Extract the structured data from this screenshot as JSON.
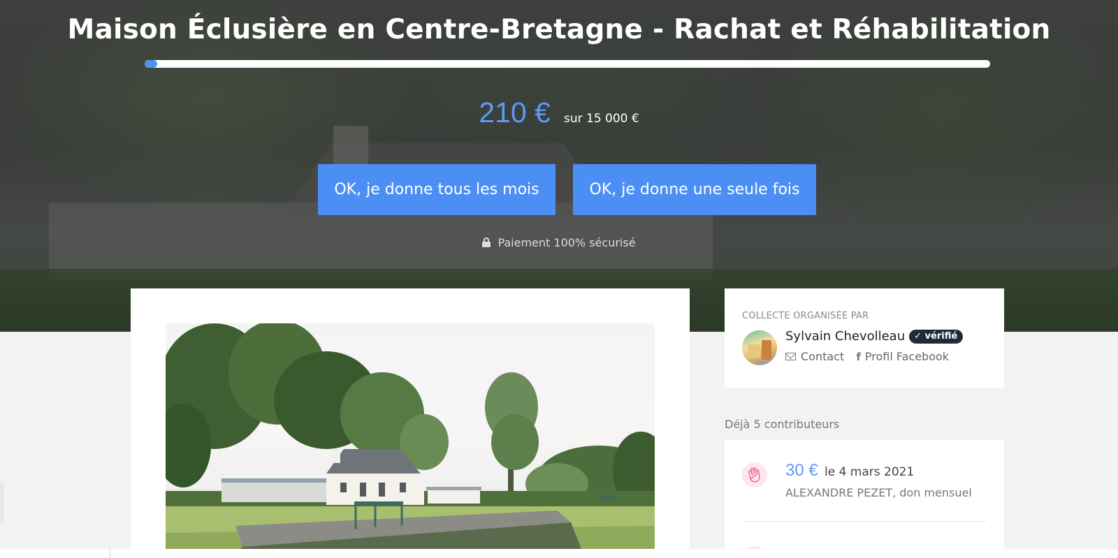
{
  "campaign": {
    "title": "Maison Éclusière en Centre-Bretagne - Rachat et Réhabilitation",
    "raised": "210 €",
    "goal": "sur 15 000 €",
    "progress_fraction": 0.014
  },
  "actions": {
    "monthly_label": "OK, je donne tous les mois",
    "once_label": "OK, je donne une seule fois",
    "secure_text": "Paiement 100% sécurisé"
  },
  "organizer": {
    "heading": "Collecte organisée par",
    "name": "Sylvain Chevolleau",
    "verified_label": "✓ vérifié",
    "contact_label": "Contact",
    "facebook_label": "Profil Facebook"
  },
  "contributors": {
    "heading": "Déjà 5 contributeurs",
    "items": [
      {
        "amount": "30 €",
        "date": "le 4 mars 2021",
        "name": "ALEXANDRE PEZET, don mensuel"
      }
    ]
  },
  "colors": {
    "accent": "#4b8ff5",
    "amount_blue": "#5b9bf3",
    "verified_badge": "#1f2b3a"
  },
  "icons": {
    "lock": "lock-icon",
    "mail": "envelope-icon",
    "facebook": "facebook-icon",
    "clap": "clapping-hands-icon"
  }
}
